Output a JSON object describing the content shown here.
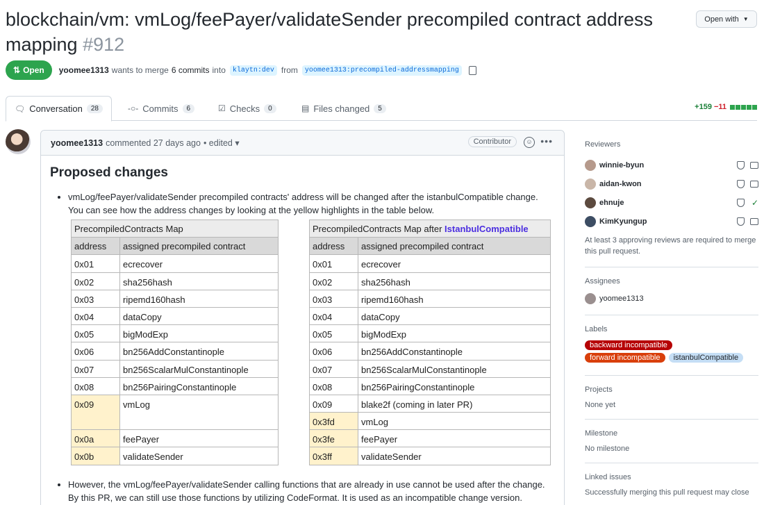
{
  "pr": {
    "title": "blockchain/vm: vmLog/feePayer/validateSender precompiled contract address mapping",
    "number": "#912",
    "open_with": "Open with",
    "state": "Open",
    "author": "yoomee1313",
    "merge_text_a": "wants to merge",
    "commits_count": "6 commits",
    "merge_text_b": "into",
    "base_branch": "klaytn:dev",
    "from_text": "from",
    "head_branch": "yoomee1313:precompiled-addressmapping"
  },
  "tabs": [
    {
      "label": "Conversation",
      "count": "28"
    },
    {
      "label": "Commits",
      "count": "6"
    },
    {
      "label": "Checks",
      "count": "0"
    },
    {
      "label": "Files changed",
      "count": "5"
    }
  ],
  "diffstat": {
    "additions": "+159",
    "deletions": "−11"
  },
  "comment": {
    "author": "yoomee1313",
    "action": "commented 27 days ago",
    "edited": "• edited",
    "role": "Contributor",
    "heading": "Proposed changes",
    "bullet1": "vmLog/feePayer/validateSender precompiled contracts' address will be changed after the istanbulCompatible change. You can see how the address changes by looking at the yellow highlights in the table below.",
    "bullet2": "However, the vmLog/feePayer/validateSender calling functions that are already in use cannot be used after the change. By this PR, we can still use those functions by utilizing CodeFormat. It is used as an incompatible change version."
  },
  "table_left": {
    "title": "PrecompiledContracts Map",
    "col1": "address",
    "col2": "assigned precompiled contract",
    "rows": [
      [
        "0x01",
        "ecrecover"
      ],
      [
        "0x02",
        "sha256hash"
      ],
      [
        "0x03",
        "ripemd160hash"
      ],
      [
        "0x04",
        "dataCopy"
      ],
      [
        "0x05",
        "bigModExp"
      ],
      [
        "0x06",
        "bn256AddConstantinople"
      ],
      [
        "0x07",
        "bn256ScalarMulConstantinople"
      ],
      [
        "0x08",
        "bn256PairingConstantinople"
      ],
      [
        "0x09",
        "vmLog"
      ],
      [
        "0x0a",
        "feePayer"
      ],
      [
        "0x0b",
        "validateSender"
      ]
    ]
  },
  "table_right": {
    "title_a": "PrecompiledContracts Map after",
    "title_b": "IstanbulCompatible",
    "col1": "address",
    "col2": "assigned precompiled contract",
    "rows": [
      [
        "0x01",
        "ecrecover"
      ],
      [
        "0x02",
        "sha256hash"
      ],
      [
        "0x03",
        "ripemd160hash"
      ],
      [
        "0x04",
        "dataCopy"
      ],
      [
        "0x05",
        "bigModExp"
      ],
      [
        "0x06",
        "bn256AddConstantinople"
      ],
      [
        "0x07",
        "bn256ScalarMulConstantinople"
      ],
      [
        "0x08",
        "bn256PairingConstantinople"
      ],
      [
        "0x09",
        "blake2f (coming in later PR)"
      ],
      [
        "0x3fd",
        "vmLog"
      ],
      [
        "0x3fe",
        "feePayer"
      ],
      [
        "0x3ff",
        "validateSender"
      ]
    ]
  },
  "sidebar": {
    "reviewers_title": "Reviewers",
    "reviewers": [
      "winnie-byun",
      "aidan-kwon",
      "ehnuje",
      "KimKyungup"
    ],
    "reviewers_note": "At least 3 approving reviews are required to merge this pull request.",
    "assignees_title": "Assignees",
    "assignee": "yoomee1313",
    "labels_title": "Labels",
    "labels": [
      "backward incompatible",
      "forward incompatible",
      "istanbulCompatible"
    ],
    "projects_title": "Projects",
    "projects_value": "None yet",
    "milestone_title": "Milestone",
    "milestone_value": "No milestone",
    "linked_title": "Linked issues",
    "linked_value": "Successfully merging this pull request may close"
  },
  "colors": {
    "open_green": "#2da44e",
    "highlight": "#fff2cc",
    "accent_blue": "#0969da"
  }
}
